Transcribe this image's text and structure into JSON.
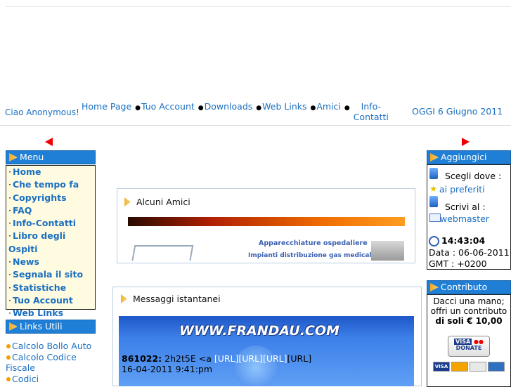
{
  "header": {
    "greeting": "Ciao Anonymous!",
    "date": "OGGI 6 Giugno 2011",
    "nav": [
      "Home Page",
      "Tuo Account",
      "Downloads",
      "Web Links",
      "Amici",
      "Info-Contatti"
    ]
  },
  "left": {
    "menu_title": "Menu",
    "menu_items": [
      "Home",
      "Che tempo fa",
      "Copyrights",
      "FAQ",
      "Info-Contatti",
      "Libro degli Ospiti",
      "News",
      "Segnala il sito",
      "Statistiche",
      "Tuo Account",
      "Web Links"
    ],
    "links_title": "Links Utili",
    "links": [
      "Calcolo Bollo Auto",
      "Calcolo Codice Fiscale",
      "Codici"
    ]
  },
  "center": {
    "friends_title": "Alcuni Amici",
    "ad_line1": "Apparecchiature ospedaliere",
    "ad_line2": "Impianti distribuzione gas medicali",
    "messages_title": "Messaggi istantanei",
    "banner_text": "WWW.FRANDAU.COM",
    "message": {
      "id": "861022:",
      "text": "2h2t5E <a",
      "url_labels": [
        "[URL]",
        "[URL]",
        "[URL]",
        "[URL]"
      ],
      "timestamp": "16-04-2011 9:41:pm"
    }
  },
  "right": {
    "add_title": "Aggiungici",
    "choose_label": "Scegli dove :",
    "favorites_label": "ai preferiti",
    "write_label": "Scrivi al :",
    "webmaster_label": "webmaster",
    "time": "14:43:04",
    "date_label": "Data : 06-06-2011",
    "gmt_label": "GMT : +0200",
    "contrib_title": "Contributo",
    "contrib_line1": "Dacci una mano;",
    "contrib_line2": "offri un contributo",
    "contrib_line3": "di soli € 10,00",
    "donate_label": "DONATE"
  }
}
